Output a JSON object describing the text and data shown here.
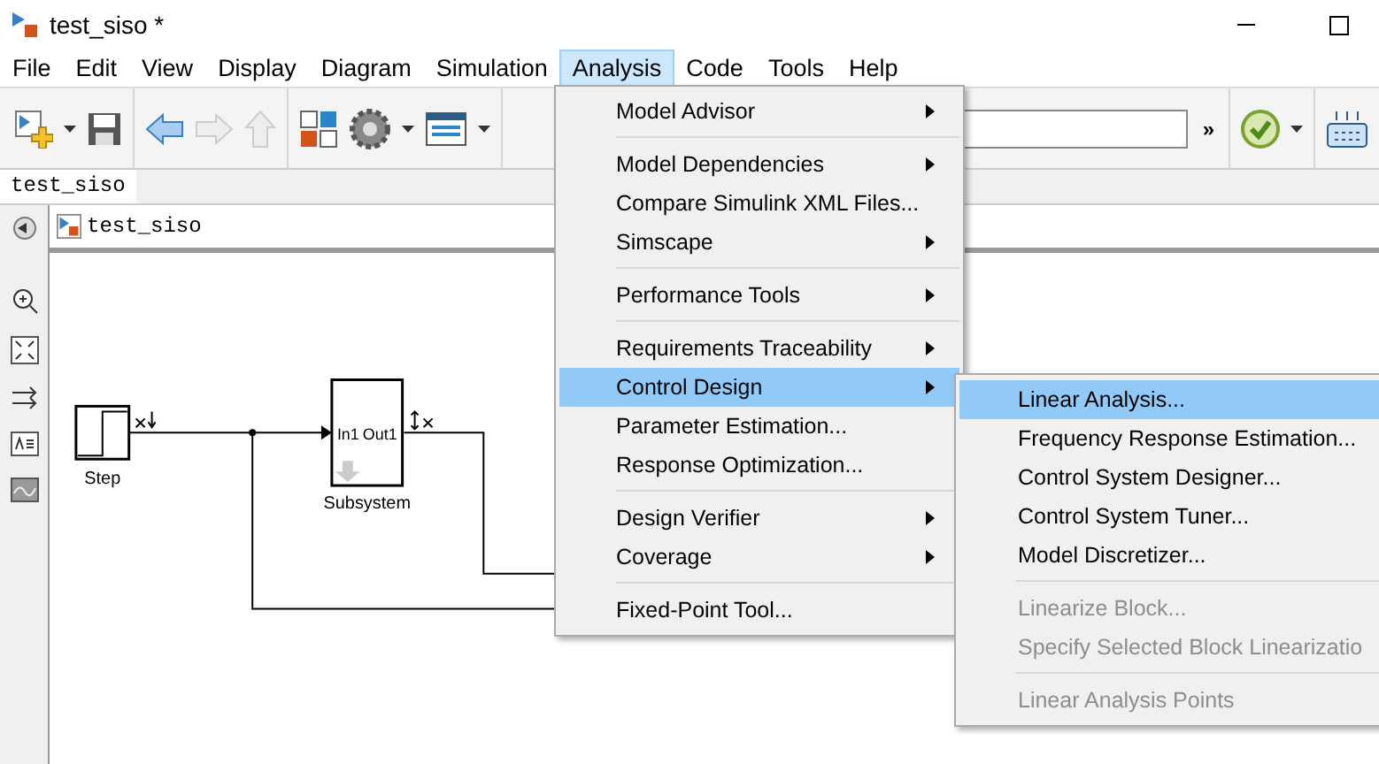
{
  "window": {
    "title": "test_siso *"
  },
  "menubar": [
    {
      "label": "File",
      "selected": false
    },
    {
      "label": "Edit",
      "selected": false
    },
    {
      "label": "View",
      "selected": false
    },
    {
      "label": "Display",
      "selected": false
    },
    {
      "label": "Diagram",
      "selected": false
    },
    {
      "label": "Simulation",
      "selected": false
    },
    {
      "label": "Analysis",
      "selected": true
    },
    {
      "label": "Code",
      "selected": false
    },
    {
      "label": "Tools",
      "selected": false
    },
    {
      "label": "Help",
      "selected": false
    }
  ],
  "toolbar": {
    "more": "»"
  },
  "tabs": [
    {
      "label": "test_siso",
      "selected": true
    }
  ],
  "breadcrumb": "test_siso",
  "diagram": {
    "step_label": "Step",
    "subsystem_label": "Subsystem",
    "in_port": "In1",
    "out_port": "Out1"
  },
  "menu": [
    {
      "kind": "item",
      "label": "Model Advisor",
      "submenu": true,
      "selected": false,
      "disabled": false
    },
    {
      "kind": "separator"
    },
    {
      "kind": "item",
      "label": "Model Dependencies",
      "submenu": true,
      "selected": false,
      "disabled": false
    },
    {
      "kind": "item",
      "label": "Compare Simulink XML Files...",
      "submenu": false,
      "selected": false,
      "disabled": false
    },
    {
      "kind": "item",
      "label": "Simscape",
      "submenu": true,
      "selected": false,
      "disabled": false
    },
    {
      "kind": "separator"
    },
    {
      "kind": "item",
      "label": "Performance Tools",
      "submenu": true,
      "selected": false,
      "disabled": false
    },
    {
      "kind": "separator"
    },
    {
      "kind": "item",
      "label": "Requirements Traceability",
      "submenu": true,
      "selected": false,
      "disabled": false
    },
    {
      "kind": "item",
      "label": "Control Design",
      "submenu": true,
      "selected": true,
      "disabled": false
    },
    {
      "kind": "item",
      "label": "Parameter Estimation...",
      "submenu": false,
      "selected": false,
      "disabled": false
    },
    {
      "kind": "item",
      "label": "Response Optimization...",
      "submenu": false,
      "selected": false,
      "disabled": false
    },
    {
      "kind": "separator"
    },
    {
      "kind": "item",
      "label": "Design Verifier",
      "submenu": true,
      "selected": false,
      "disabled": false
    },
    {
      "kind": "item",
      "label": "Coverage",
      "submenu": true,
      "selected": false,
      "disabled": false
    },
    {
      "kind": "separator"
    },
    {
      "kind": "item",
      "label": "Fixed-Point Tool...",
      "submenu": false,
      "selected": false,
      "disabled": false
    }
  ],
  "submenu": [
    {
      "kind": "item",
      "label": "Linear Analysis...",
      "selected": true,
      "disabled": false
    },
    {
      "kind": "item",
      "label": "Frequency Response Estimation...",
      "selected": false,
      "disabled": false
    },
    {
      "kind": "item",
      "label": "Control System Designer...",
      "selected": false,
      "disabled": false
    },
    {
      "kind": "item",
      "label": "Control System Tuner...",
      "selected": false,
      "disabled": false
    },
    {
      "kind": "item",
      "label": "Model Discretizer...",
      "selected": false,
      "disabled": false
    },
    {
      "kind": "separator"
    },
    {
      "kind": "item",
      "label": "Linearize Block...",
      "selected": false,
      "disabled": true
    },
    {
      "kind": "item",
      "label": "Specify Selected Block Linearizatio",
      "selected": false,
      "disabled": true
    },
    {
      "kind": "separator"
    },
    {
      "kind": "item",
      "label": "Linear Analysis Points",
      "selected": false,
      "disabled": true
    }
  ]
}
